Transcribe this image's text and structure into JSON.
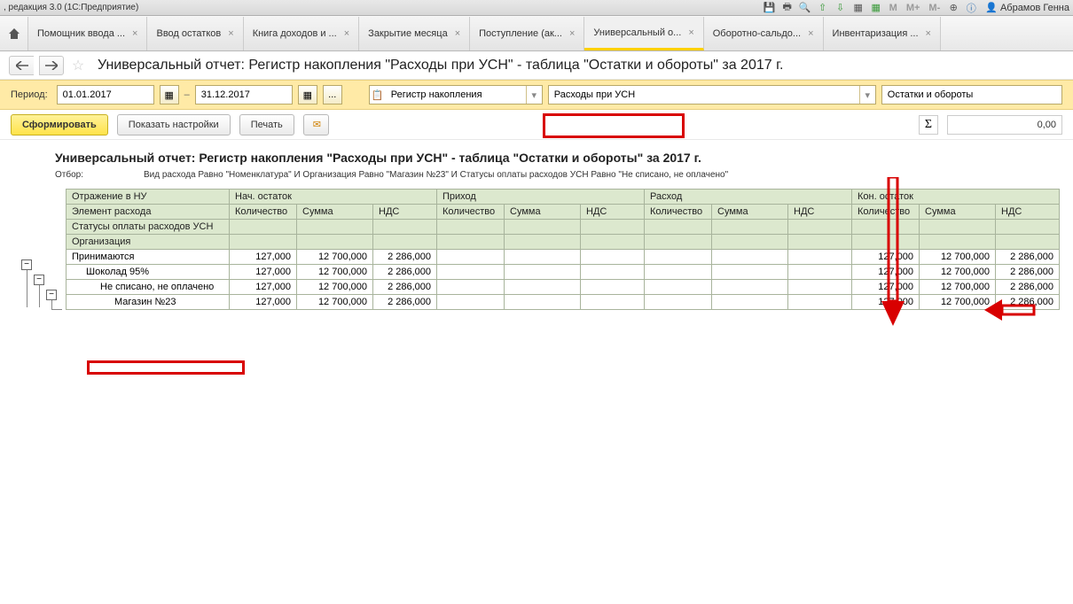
{
  "sysbar": {
    "title": ", редакция 3.0  (1С:Предприятие)",
    "zoom_m": "M",
    "zoom_mp": "M+",
    "zoom_mm": "M-",
    "user": "Абрамов Генна"
  },
  "tabs": [
    {
      "label": "Помощник ввода ...",
      "active": false
    },
    {
      "label": "Ввод остатков",
      "active": false
    },
    {
      "label": "Книга доходов и ...",
      "active": false
    },
    {
      "label": "Закрытие месяца",
      "active": false
    },
    {
      "label": "Поступление (ак...",
      "active": false
    },
    {
      "label": "Универсальный о...",
      "active": true
    },
    {
      "label": "Оборотно-сальдо...",
      "active": false
    },
    {
      "label": "Инвентаризация ...",
      "active": false
    }
  ],
  "page_title": "Универсальный отчет: Регистр накопления \"Расходы при УСН\" - таблица \"Остатки и обороты\" за 2017 г.",
  "period": {
    "label": "Период:",
    "from": "01.01.2017",
    "to": "31.12.2017"
  },
  "selectors": {
    "reg_type": "Регистр накопления",
    "reg_name": "Расходы при УСН",
    "table": "Остатки и обороты"
  },
  "buttons": {
    "form": "Сформировать",
    "settings": "Показать настройки",
    "print": "Печать"
  },
  "sum_value": "0,00",
  "report": {
    "title": "Универсальный отчет: Регистр накопления \"Расходы при УСН\" - таблица \"Остатки и обороты\" за 2017 г.",
    "filter_label": "Отбор:",
    "filter_value": "Вид расхода Равно \"Номенклатура\" И Организация Равно \"Магазин №23\" И Статусы оплаты расходов УСН Равно \"Не списано, не оплачено\""
  },
  "grid": {
    "row_headers": [
      "Отражение в НУ",
      "Элемент расхода",
      "Статусы оплаты расходов УСН",
      "Организация"
    ],
    "group_cols": [
      "Нач. остаток",
      "Приход",
      "Расход",
      "Кон. остаток"
    ],
    "sub_cols": [
      "Количество",
      "Сумма",
      "НДС"
    ],
    "rows": [
      {
        "label": "Принимаются",
        "indent": 0,
        "nach": {
          "q": "127,000",
          "s": "12 700,000",
          "v": "2 286,000"
        },
        "kon": {
          "q": "127,000",
          "s": "12 700,000",
          "v": "2 286,000"
        }
      },
      {
        "label": "Шоколад 95%",
        "indent": 1,
        "nach": {
          "q": "127,000",
          "s": "12 700,000",
          "v": "2 286,000"
        },
        "kon": {
          "q": "127,000",
          "s": "12 700,000",
          "v": "2 286,000"
        }
      },
      {
        "label": "Не списано, не оплачено",
        "indent": 2,
        "nach": {
          "q": "127,000",
          "s": "12 700,000",
          "v": "2 286,000"
        },
        "kon": {
          "q": "127,000",
          "s": "12 700,000",
          "v": "2 286,000"
        }
      },
      {
        "label": "Магазин №23",
        "indent": 3,
        "nach": {
          "q": "127,000",
          "s": "12 700,000",
          "v": "2 286,000"
        },
        "kon": {
          "q": "127,000",
          "s": "12 700,000",
          "v": "2 286,000"
        }
      }
    ]
  }
}
